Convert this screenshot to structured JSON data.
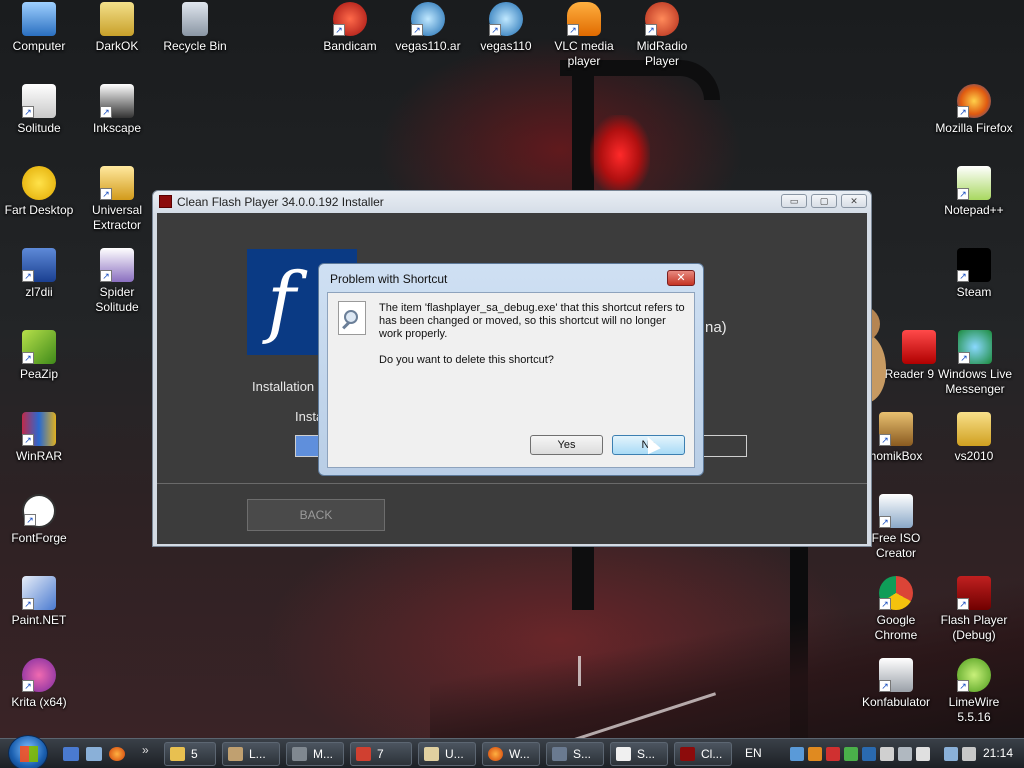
{
  "desktop_left": [
    {
      "label": "Computer"
    },
    {
      "label": "DarkOK"
    },
    {
      "label": "Recycle Bin"
    },
    {
      "label": "Solitude"
    },
    {
      "label": "Inkscape"
    },
    {
      "label": "Fart Desktop"
    },
    {
      "label": "Universal Extractor"
    },
    {
      "label": "zl7dii"
    },
    {
      "label": "Spider Solitude"
    },
    {
      "label": "PeaZip"
    },
    {
      "label": "WinRAR"
    },
    {
      "label": "FontForge"
    },
    {
      "label": "Paint.NET"
    },
    {
      "label": "Krita (x64)"
    }
  ],
  "desktop_top": [
    {
      "label": "Bandicam"
    },
    {
      "label": "vegas110.ar"
    },
    {
      "label": "vegas110"
    },
    {
      "label": "VLC media player"
    },
    {
      "label": "MidRadio Player"
    }
  ],
  "desktop_right": [
    {
      "label": "Mozilla Firefox"
    },
    {
      "label": "Notepad++"
    },
    {
      "label": "Steam"
    },
    {
      "label": "Reader 9"
    },
    {
      "label": "Windows Live Messenger"
    },
    {
      "label": "homikBox"
    },
    {
      "label": "vs2010"
    },
    {
      "label": "Free ISO Creator"
    },
    {
      "label": "Google Chrome"
    },
    {
      "label": "Flash Player (Debug)"
    },
    {
      "label": "Konfabulator"
    },
    {
      "label": "LimeWire 5.5.16"
    }
  ],
  "installer": {
    "title": "Clean Flash Player 34.0.0.192 Installer",
    "logo_letter": "f",
    "partial_right_text": "na)",
    "installation_label": "Installation",
    "progress_label": "Insta",
    "progress_fraction": 0.05,
    "back_label": "BACK",
    "minimize": "▭",
    "maximize": "▢",
    "close": "✕"
  },
  "dialog": {
    "title": "Problem with Shortcut",
    "close": "✕",
    "message": "The item 'flashplayer_sa_debug.exe' that this shortcut refers to has been changed or moved, so this shortcut will no longer work properly.",
    "question": "Do you want to delete this shortcut?",
    "yes_label": "Yes",
    "no_label": "No"
  },
  "taskbar": {
    "buttons": [
      {
        "label": "5"
      },
      {
        "label": "L..."
      },
      {
        "label": "M..."
      },
      {
        "label": "7"
      },
      {
        "label": "U..."
      },
      {
        "label": "W..."
      },
      {
        "label": "S..."
      },
      {
        "label": "S..."
      },
      {
        "label": "Cl..."
      }
    ],
    "language": "EN",
    "clock": "21:14"
  }
}
